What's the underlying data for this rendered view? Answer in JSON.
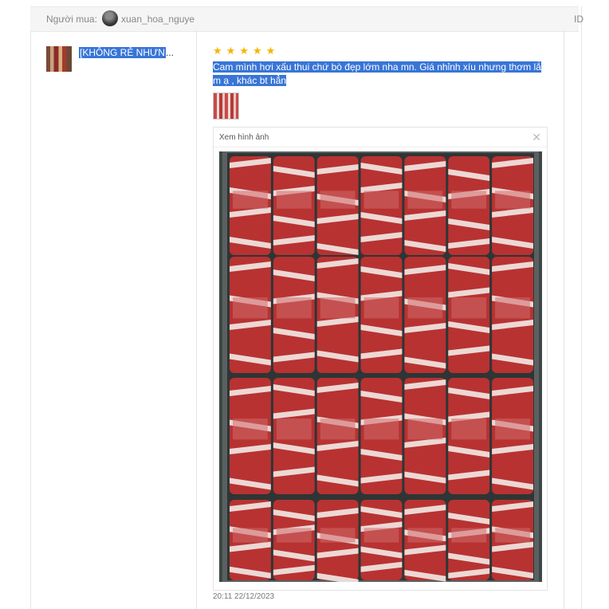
{
  "header": {
    "buyer_label": "Người mua:",
    "buyer_name": "xuan_hoa_nguye",
    "id_label": "ID"
  },
  "product": {
    "title": "[KHÔNG RẺ NHƯN",
    "ellipsis": "..."
  },
  "review": {
    "rating": 5,
    "stars": [
      "★",
      "★",
      "★",
      "★",
      "★"
    ],
    "comment_line1": "Cam mình hơi xấu thui chứ bò đẹp lớm nha mn. Giá nhỉnh xíu nhưng thơm lắ",
    "comment_line2": "m ạ , khác bt hẳn",
    "timestamp": "20:11 22/12/2023"
  },
  "viewer": {
    "title": "Xem hình ảnh",
    "close": "✕"
  },
  "colors": {
    "selection": "#3875d7",
    "star": "#f5b400",
    "meat_red": "#b83232",
    "fat_white": "#f1e6e2"
  }
}
